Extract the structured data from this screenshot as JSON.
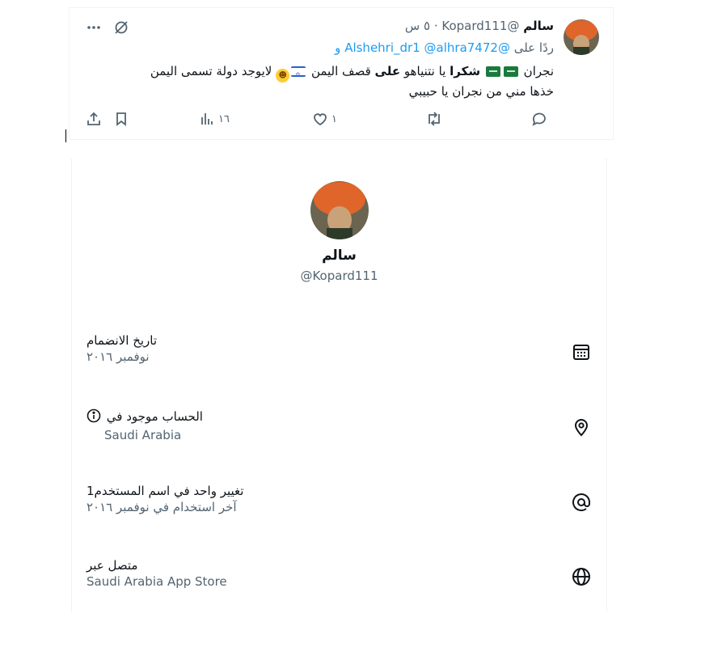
{
  "tweet": {
    "name": "سالم",
    "handle": "@Kopard111",
    "dot": "·",
    "time": "٥ س",
    "reply_prefix": "ردًا على",
    "reply_mentions": [
      "@Alshehri_dr1",
      "@alhra7472",
      "و"
    ],
    "body": {
      "line1_part1": "نجران",
      "line1_bold": "شكرا",
      "line1_part2": "يا نتنياهو",
      "line1_bold2": "على",
      "line1_part3": "قصف اليمن",
      "line1_part4": "لايوجد دولة تسمى اليمن",
      "line2": "خذها مني من نجران يا حبيبي"
    },
    "stats": {
      "views": "١٦",
      "likes": "١",
      "retweets": "",
      "replies": ""
    }
  },
  "profile": {
    "name": "سالم",
    "handle": "@Kopard111"
  },
  "about": [
    {
      "title": "تاريخ الانضمام",
      "sub": "نوفمبر ٢٠١٦",
      "icon": "calendar-icon"
    },
    {
      "title": "الحساب موجود في",
      "sub": "Saudi Arabia",
      "icon": "location-pin-icon"
    },
    {
      "title": "تغيير واحد في اسم المستخدم1",
      "sub": "آخر استخدام في نوفمبر ٢٠١٦",
      "icon": "at-sign-icon"
    },
    {
      "title": "متصل عبر",
      "sub": "Saudi Arabia App Store",
      "icon": "globe-icon"
    }
  ],
  "colors": {
    "link": "#1d9bf0",
    "muted": "#536471",
    "text": "#0f1419"
  }
}
